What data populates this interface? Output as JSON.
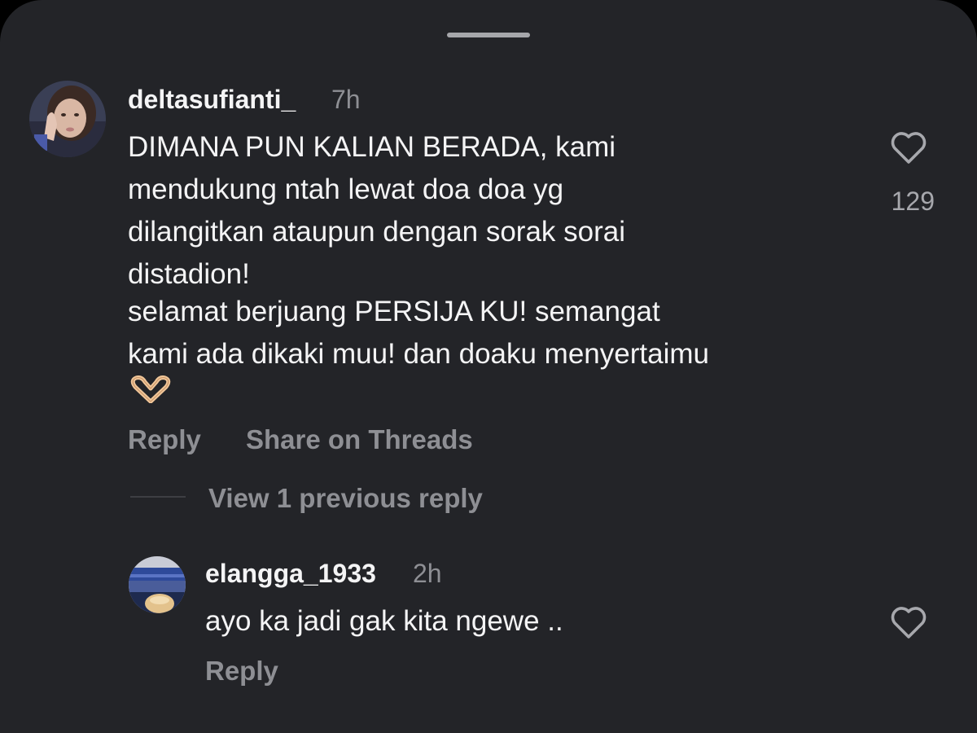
{
  "comments": [
    {
      "username": "deltasufianti_",
      "time": "7h",
      "paragraph1": "DIMANA PUN KALIAN BERADA, kami\nmendukung ntah lewat doa doa yg\ndilangitkan ataupun dengan sorak sorai\ndistadion!",
      "paragraph2": "selamat berjuang PERSIJA KU! semangat\nkami ada dikaki muu! dan doaku menyertaimu",
      "emoji": "🫶",
      "likes": "129",
      "reply_label": "Reply",
      "share_label": "Share on Threads"
    }
  ],
  "view_previous": "View 1 previous reply",
  "replies": [
    {
      "username": "elangga_1933",
      "time": "2h",
      "text": "ayo ka jadi gak kita ngewe ..",
      "reply_label": "Reply"
    }
  ],
  "colors": {
    "background": "#232428",
    "primary_text": "#f4f4f5",
    "secondary_text": "#8e8f94"
  }
}
